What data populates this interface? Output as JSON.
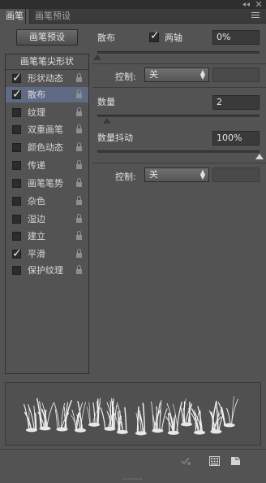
{
  "window": {
    "collapse_icon": "collapse-double-arrow-icon",
    "close_icon": "close-x-icon"
  },
  "tabs": [
    {
      "label": "画笔",
      "active": true
    },
    {
      "label": "画笔预设",
      "active": false
    }
  ],
  "preset_button": "画笔预设",
  "list_header": "画笔笔尖形状",
  "list_items": [
    {
      "label": "形状动态",
      "checked": true,
      "selected": false
    },
    {
      "label": "散布",
      "checked": true,
      "selected": true
    },
    {
      "label": "纹理",
      "checked": false,
      "selected": false
    },
    {
      "label": "双重画笔",
      "checked": false,
      "selected": false
    },
    {
      "label": "颜色动态",
      "checked": false,
      "selected": false
    },
    {
      "label": "传递",
      "checked": false,
      "selected": false
    },
    {
      "label": "画笔笔势",
      "checked": false,
      "selected": false
    },
    {
      "label": "杂色",
      "checked": false,
      "selected": false
    },
    {
      "label": "湿边",
      "checked": false,
      "selected": false
    },
    {
      "label": "建立",
      "checked": false,
      "selected": false
    },
    {
      "label": "平滑",
      "checked": true,
      "selected": false
    },
    {
      "label": "保护纹理",
      "checked": false,
      "selected": false
    }
  ],
  "scatter": {
    "label": "散布",
    "both_axes_label": "两轴",
    "both_axes_checked": true,
    "value": "0%",
    "slider_level": 0,
    "control_label": "控制:",
    "control_value": "关"
  },
  "count": {
    "label": "数量",
    "value": "2",
    "slider_level": 0.06
  },
  "count_jitter": {
    "label": "数量抖动",
    "value": "100%",
    "slider_level": 1.0,
    "control_label": "控制:",
    "control_value": "关"
  },
  "bottom_icons": [
    "toggle-live-tip-icon",
    "grid-view-icon",
    "create-new-preset-icon"
  ],
  "colors": {
    "panel_bg": "#535353",
    "selected_row": "#5f6b85",
    "input_bg": "#3a3a3a"
  }
}
